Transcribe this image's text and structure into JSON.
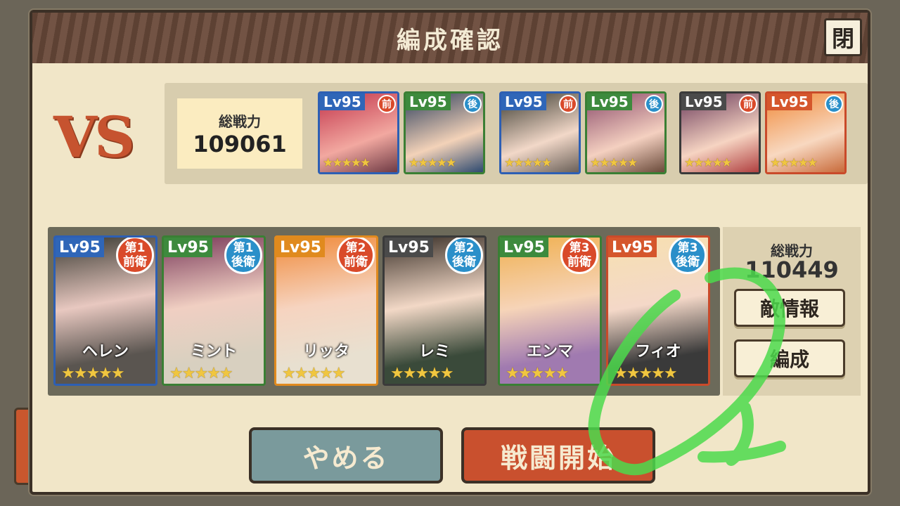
{
  "dialog": {
    "title": "編成確認",
    "close_label": "閉"
  },
  "vs_label": "VS",
  "enemy": {
    "power_label": "総戦力",
    "power_value": "109061",
    "cards": [
      {
        "level": "Lv95",
        "position": "前",
        "stars": "★★★★★",
        "lv_color": "#2f66b8",
        "badge_color": "#d94a2a",
        "frame": "#2d5fb4",
        "art": "linear-gradient(160deg,#c2334a,#f2a8a0 60%,#6e3a44)"
      },
      {
        "level": "Lv95",
        "position": "後",
        "stars": "★★★★★",
        "lv_color": "#3d8a3d",
        "badge_color": "#2a8fc9",
        "frame": "#3a7f34",
        "art": "linear-gradient(160deg,#2c3e5c,#f3d2b8 60%,#2e4a70)"
      },
      {
        "level": "Lv95",
        "position": "前",
        "stars": "★★★★★",
        "lv_color": "#2f66b8",
        "badge_color": "#d94a2a",
        "frame": "#2d5fb4",
        "art": "linear-gradient(160deg,#3a3a30,#f2d8c8 60%,#6a6058)"
      },
      {
        "level": "Lv95",
        "position": "後",
        "stars": "★★★★★",
        "lv_color": "#3d8a3d",
        "badge_color": "#2a8fc9",
        "frame": "#3a7f34",
        "art": "linear-gradient(160deg,#8a4a6a,#f4d0c0 60%,#6a4a3a)"
      },
      {
        "level": "Lv95",
        "position": "前",
        "stars": "★★★★★",
        "lv_color": "#4a4a4a",
        "badge_color": "#d94a2a",
        "frame": "#3a3a3a",
        "art": "linear-gradient(160deg,#6a3a5a,#f6d4c2 60%,#b04040)"
      },
      {
        "level": "Lv95",
        "position": "後",
        "stars": "★★★★★",
        "lv_color": "#d5562c",
        "badge_color": "#2a8fc9",
        "frame": "#c94a2a",
        "art": "linear-gradient(160deg,#f08a3a,#f8d8c0 60%,#c86a3a)"
      }
    ]
  },
  "ally": {
    "power_label": "総戦力",
    "power_value": "110449",
    "cards": [
      {
        "level": "Lv95",
        "rank": "第1",
        "role": "前衛",
        "name": "ヘレン",
        "stars": "★★★★★",
        "lv_color": "#2f66b8",
        "badge_color": "#d94a2a",
        "frame": "#2d5fb4",
        "art": "linear-gradient(170deg,#3a3a32,#e8c8c0 45%,#5a5550 80%)"
      },
      {
        "level": "Lv95",
        "rank": "第1",
        "role": "後衛",
        "name": "ミント",
        "stars": "★★★★★",
        "lv_color": "#3d8a3d",
        "badge_color": "#2a8fc9",
        "frame": "#3a7f34",
        "art": "linear-gradient(170deg,#7a3a5a,#f0cfc2 45%,#d8d0c0 80%)"
      },
      {
        "level": "Lv95",
        "rank": "第2",
        "role": "前衛",
        "name": "リッタ",
        "stars": "★★★★★",
        "lv_color": "#e08a1e",
        "badge_color": "#d94a2a",
        "frame": "#e08a1e",
        "art": "linear-gradient(170deg,#f08a3a,#f6d4c0 45%,#e8e0d0 80%)"
      },
      {
        "level": "Lv95",
        "rank": "第2",
        "role": "後衛",
        "name": "レミ",
        "stars": "★★★★★",
        "lv_color": "#4a4a4a",
        "badge_color": "#2a8fc9",
        "frame": "#3a3a3a",
        "art": "linear-gradient(170deg,#3a3028,#f2d8c6 45%,#3a4a3a 80%)"
      },
      {
        "level": "Lv95",
        "rank": "第3",
        "role": "前衛",
        "name": "エンマ",
        "stars": "★★★★★",
        "lv_color": "#3d8a3d",
        "badge_color": "#d94a2a",
        "frame": "#3a7f34",
        "art": "linear-gradient(170deg,#f0b050,#f6d4b8 45%,#a07ab0 80%)"
      },
      {
        "level": "Lv95",
        "rank": "第3",
        "role": "後衛",
        "name": "フィオ",
        "stars": "★★★★★",
        "lv_color": "#d5562c",
        "badge_color": "#2a8fc9",
        "frame": "#c94a2a",
        "art": "linear-gradient(170deg,#f6e0b0,#f4d8c8 45%,#3a3a3a 80%)"
      }
    ]
  },
  "buttons": {
    "enemy_info": "敵情報",
    "formation": "編成",
    "cancel": "やめる",
    "start_battle": "戦闘開始"
  },
  "colors": {
    "cancel_bg": "#7a9a9c",
    "start_bg": "#c9502e",
    "annotation": "#4cd94c"
  }
}
